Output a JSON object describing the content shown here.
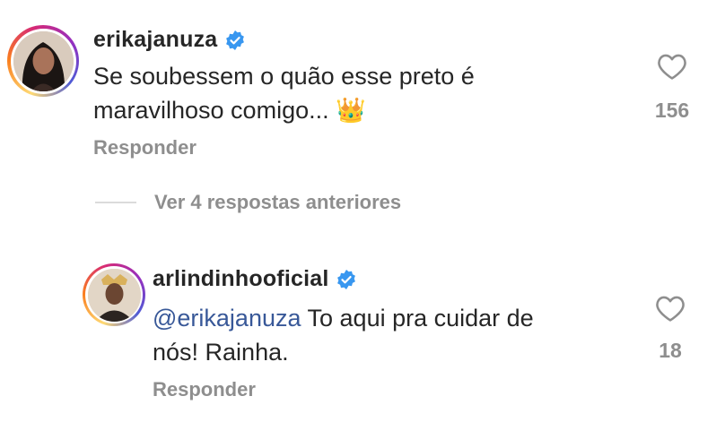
{
  "comments": [
    {
      "username": "erikajanuza",
      "verified": true,
      "text": "Se soubessem o quão esse preto é maravilhoso comigo... 👑",
      "reply_label": "Responder",
      "likes": "156",
      "icon": "heart-icon"
    },
    {
      "username": "arlindinhooficial",
      "verified": true,
      "mention": "@erikajanuza",
      "text": " To aqui pra cuidar de nós!  Rainha.",
      "reply_label": "Responder",
      "likes": "18",
      "icon": "heart-icon"
    }
  ],
  "view_replies": {
    "label": "Ver 4 respostas anteriores"
  },
  "colors": {
    "verified_blue": "#3897f0",
    "mention_blue": "#385898",
    "muted": "#8e8e8e"
  }
}
